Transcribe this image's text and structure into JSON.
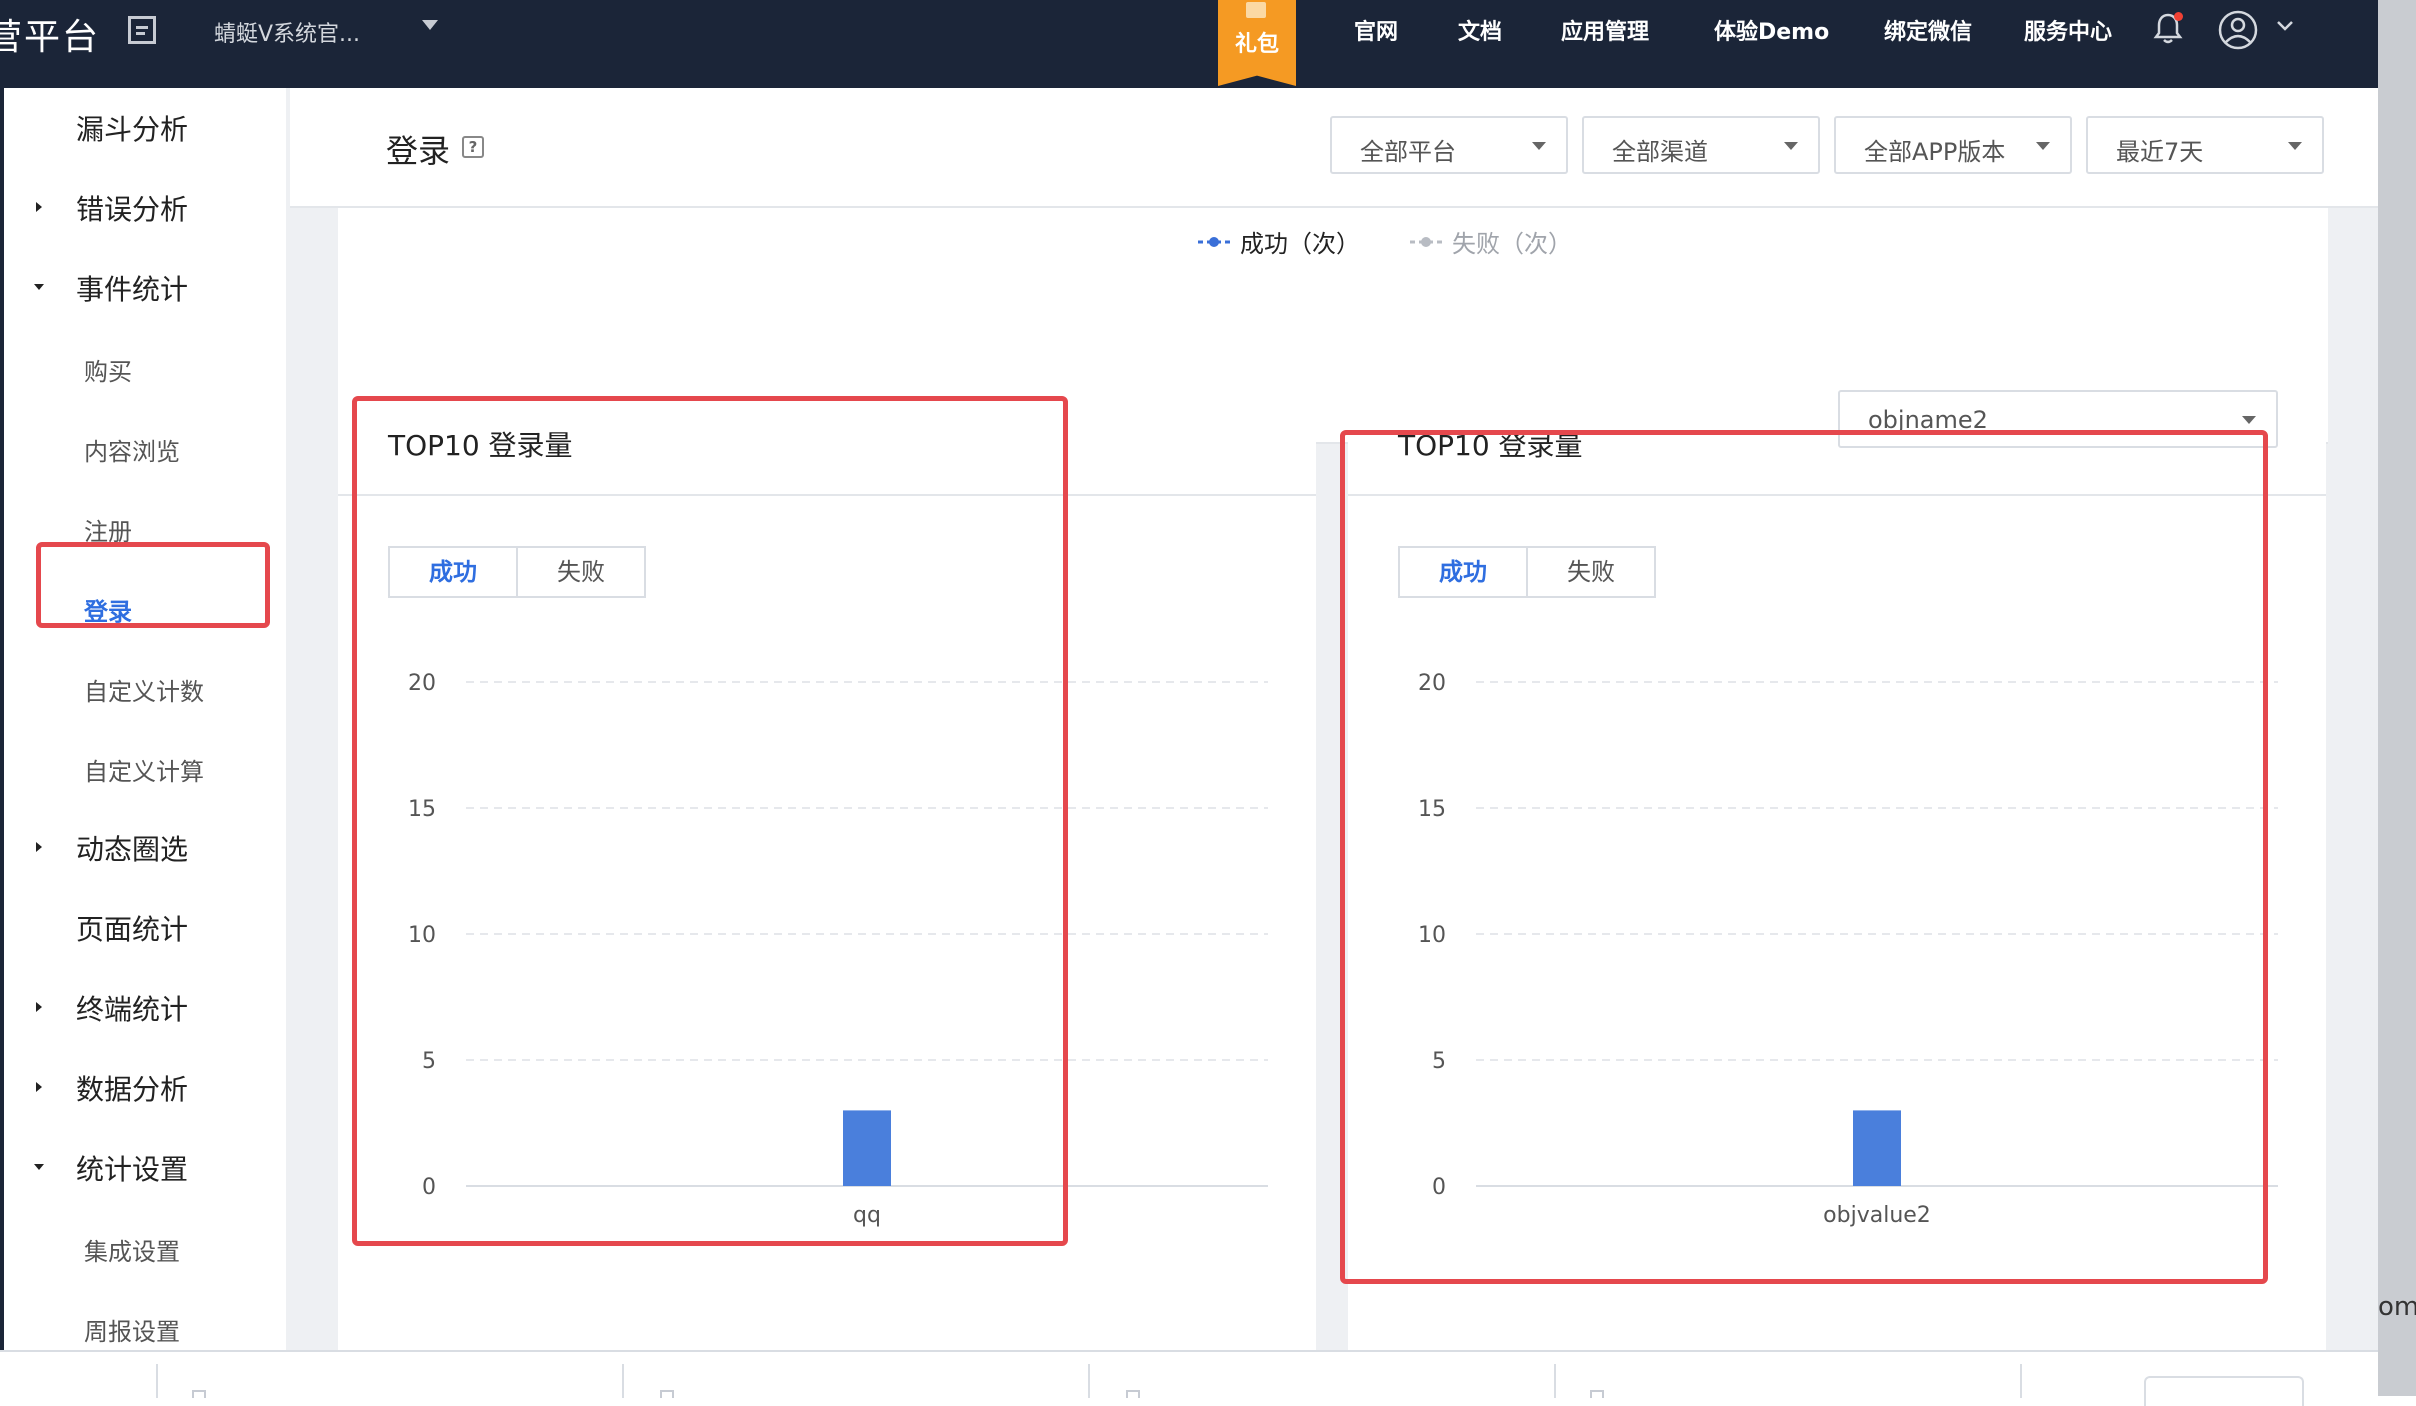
{
  "header": {
    "brand": "营平台",
    "app_name": "蜻蜓V系统官...",
    "gift_label": "礼包",
    "nav": [
      "官网",
      "文档",
      "应用管理",
      "体验Demo",
      "绑定微信",
      "服务中心"
    ]
  },
  "sidebar": {
    "items": [
      {
        "label": "漏斗分析",
        "level": "top",
        "arrow": "none"
      },
      {
        "label": "错误分析",
        "level": "top",
        "arrow": "collapsed"
      },
      {
        "label": "事件统计",
        "level": "top",
        "arrow": "expanded"
      },
      {
        "label": "购买",
        "level": "sub"
      },
      {
        "label": "内容浏览",
        "level": "sub"
      },
      {
        "label": "注册",
        "level": "sub"
      },
      {
        "label": "登录",
        "level": "sub",
        "active": true
      },
      {
        "label": "自定义计数",
        "level": "sub"
      },
      {
        "label": "自定义计算",
        "level": "sub"
      },
      {
        "label": "动态圈选",
        "level": "top",
        "arrow": "collapsed"
      },
      {
        "label": "页面统计",
        "level": "top",
        "arrow": "none"
      },
      {
        "label": "终端统计",
        "level": "top",
        "arrow": "collapsed"
      },
      {
        "label": "数据分析",
        "level": "top",
        "arrow": "collapsed"
      },
      {
        "label": "统计设置",
        "level": "top",
        "arrow": "expanded"
      },
      {
        "label": "集成设置",
        "level": "sub"
      },
      {
        "label": "周报设置",
        "level": "sub"
      }
    ]
  },
  "page": {
    "title": "登录",
    "help_icon": "question-icon",
    "filters": [
      "全部平台",
      "全部渠道",
      "全部APP版本",
      "最近7天"
    ]
  },
  "legend": [
    {
      "label": "成功（次）",
      "color": "#3a6fd8",
      "active": true
    },
    {
      "label": "失败（次）",
      "color": "#b8bcc3",
      "active": false
    }
  ],
  "cards": [
    {
      "title": "TOP10 登录量",
      "tabs": [
        "成功",
        "失败"
      ],
      "active_tab": 0,
      "select_value": ""
    },
    {
      "title": "TOP10 登录量",
      "tabs": [
        "成功",
        "失败"
      ],
      "active_tab": 0,
      "select_value": "objname2"
    }
  ],
  "chart_data": [
    {
      "type": "bar",
      "categories": [
        "qq"
      ],
      "values": [
        3
      ],
      "ylim": [
        0,
        20
      ],
      "yticks": [
        0,
        5,
        10,
        15,
        20
      ],
      "grid": true,
      "bar_color": "#4a7fdc"
    },
    {
      "type": "bar",
      "categories": [
        "objvalue2"
      ],
      "values": [
        3
      ],
      "ylim": [
        0,
        20
      ],
      "yticks": [
        0,
        5,
        10,
        15,
        20
      ],
      "grid": true,
      "bar_color": "#4a7fdc"
    }
  ],
  "colors": {
    "topbar": "#1b2538",
    "accent": "#2f6ee0",
    "highlight": "#e5484d",
    "gift": "#f59a23"
  },
  "right_edge_text": "om"
}
